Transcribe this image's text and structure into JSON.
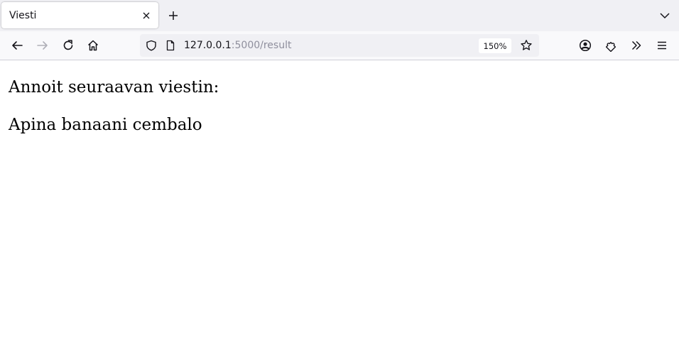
{
  "browser": {
    "tab": {
      "title": "Viesti"
    },
    "url": {
      "host": "127.0.0.1",
      "rest": ":5000/result"
    },
    "zoom": "150%",
    "icons": {
      "tab_close": "close-icon",
      "new_tab": "plus-icon",
      "tab_list": "chevron-down-icon",
      "back": "arrow-left-icon",
      "forward": "arrow-right-icon",
      "reload": "reload-icon",
      "home": "home-icon",
      "tracking_protection": "shield-icon",
      "page_info": "page-icon",
      "bookmark": "star-icon",
      "account": "account-icon",
      "extensions": "puzzle-icon",
      "overflow": "double-chevron-icon",
      "menu": "hamburger-icon"
    }
  },
  "page": {
    "heading": "Annoit seuraavan viestin:",
    "message": "Apina banaani cembalo"
  }
}
